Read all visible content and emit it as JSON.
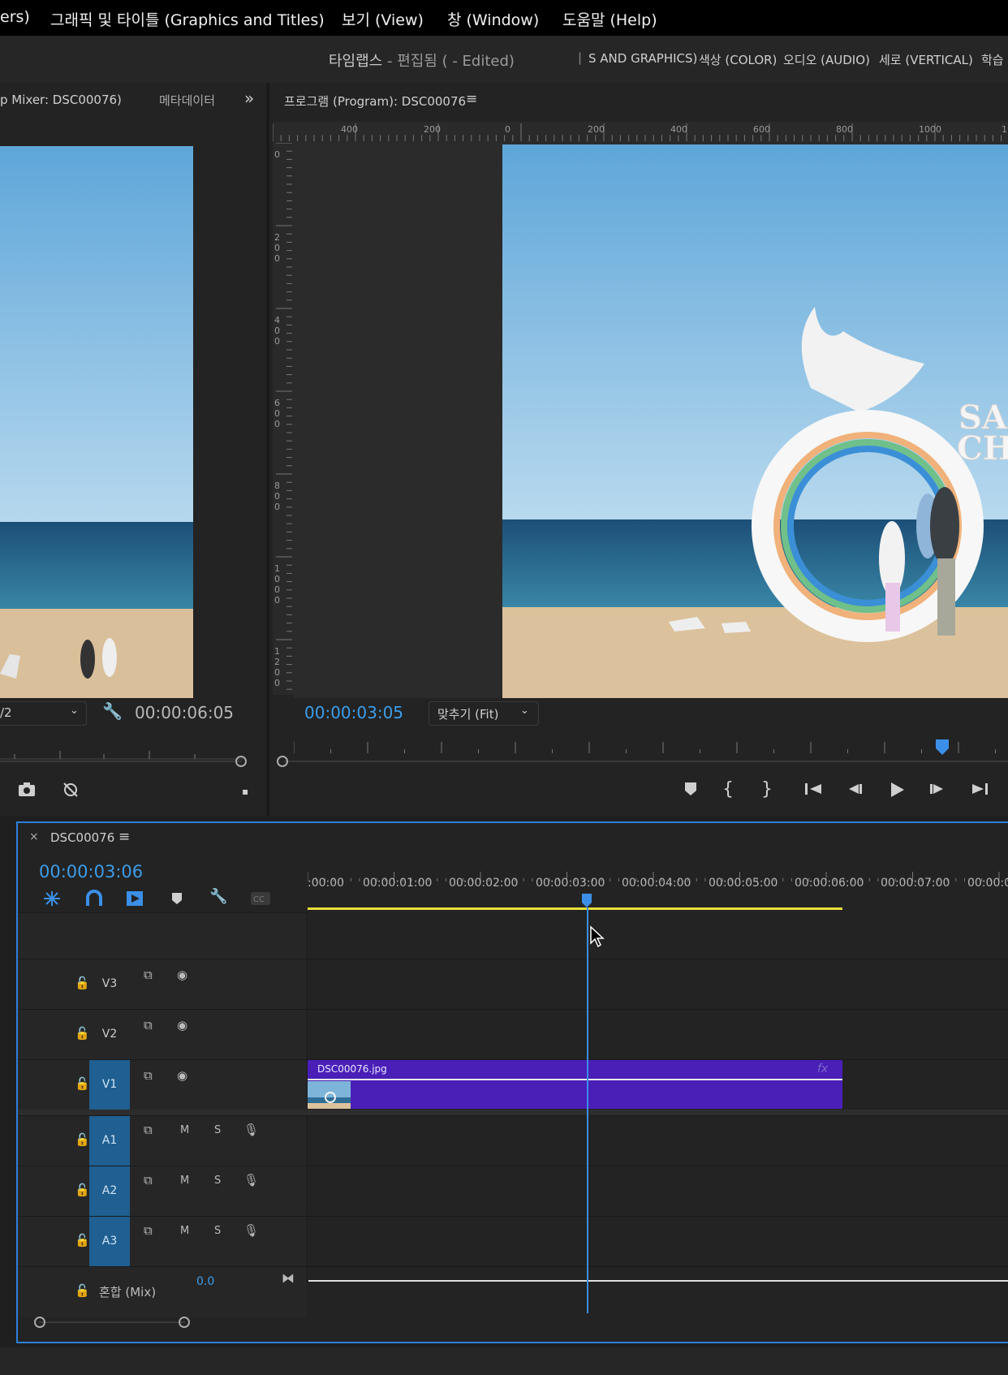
{
  "menu": {
    "items": [
      "ers)",
      "그래픽 및 타이틀 (Graphics and Titles)",
      "보기 (View)",
      "창 (Window)",
      "도움말 (Help)"
    ]
  },
  "titlebar": {
    "project": "타임랩스",
    "status": " - 편집됨 ( - Edited)",
    "workspaces": [
      "S AND GRAPHICS)",
      "색상 (COLOR)",
      "오디오 (AUDIO)",
      "세로 (VERTICAL)",
      "학습"
    ]
  },
  "source_panel": {
    "tab_label": "p Mixer: DSC00076)",
    "metadata_tab": "메타데이터",
    "zoom_value": "/2",
    "timecode": "00:00:06:05"
  },
  "program_panel": {
    "title": "프로그램 (Program): DSC00076",
    "ruler_h": [
      "400",
      "200",
      "0",
      "200",
      "400",
      "600",
      "800",
      "1000",
      "1"
    ],
    "ruler_v": [
      "0",
      "200",
      "400",
      "600",
      "800",
      "1000",
      "1200"
    ],
    "timecode": "00:00:03:05",
    "fit_label": "맞추기 (Fit)",
    "overlay_text": [
      "SA",
      "CH"
    ]
  },
  "timeline": {
    "sequence_name": "DSC00076",
    "timecode": "00:00:03:06",
    "ruler_labels": [
      ":00:00",
      "00:00:01:00",
      "00:00:02:00",
      "00:00:03:00",
      "00:00:04:00",
      "00:00:05:00",
      "00:00:06:00",
      "00:00:07:00",
      "00:00:0"
    ],
    "video_tracks": [
      "V3",
      "V2",
      "V1"
    ],
    "audio_tracks": [
      "A1",
      "A2",
      "A3"
    ],
    "mute_label": "M",
    "solo_label": "S",
    "mix_label": "혼합 (Mix)",
    "mix_value": "0.0",
    "clip_name": "DSC00076.jpg",
    "clip_fx": "fx",
    "playhead_seconds": 3.25
  },
  "colors": {
    "accent_blue": "#3b9dea",
    "clip_purple": "#4a1fb8",
    "work_area_yellow": "#e8e03a",
    "track_highlight": "#1f5f91"
  }
}
